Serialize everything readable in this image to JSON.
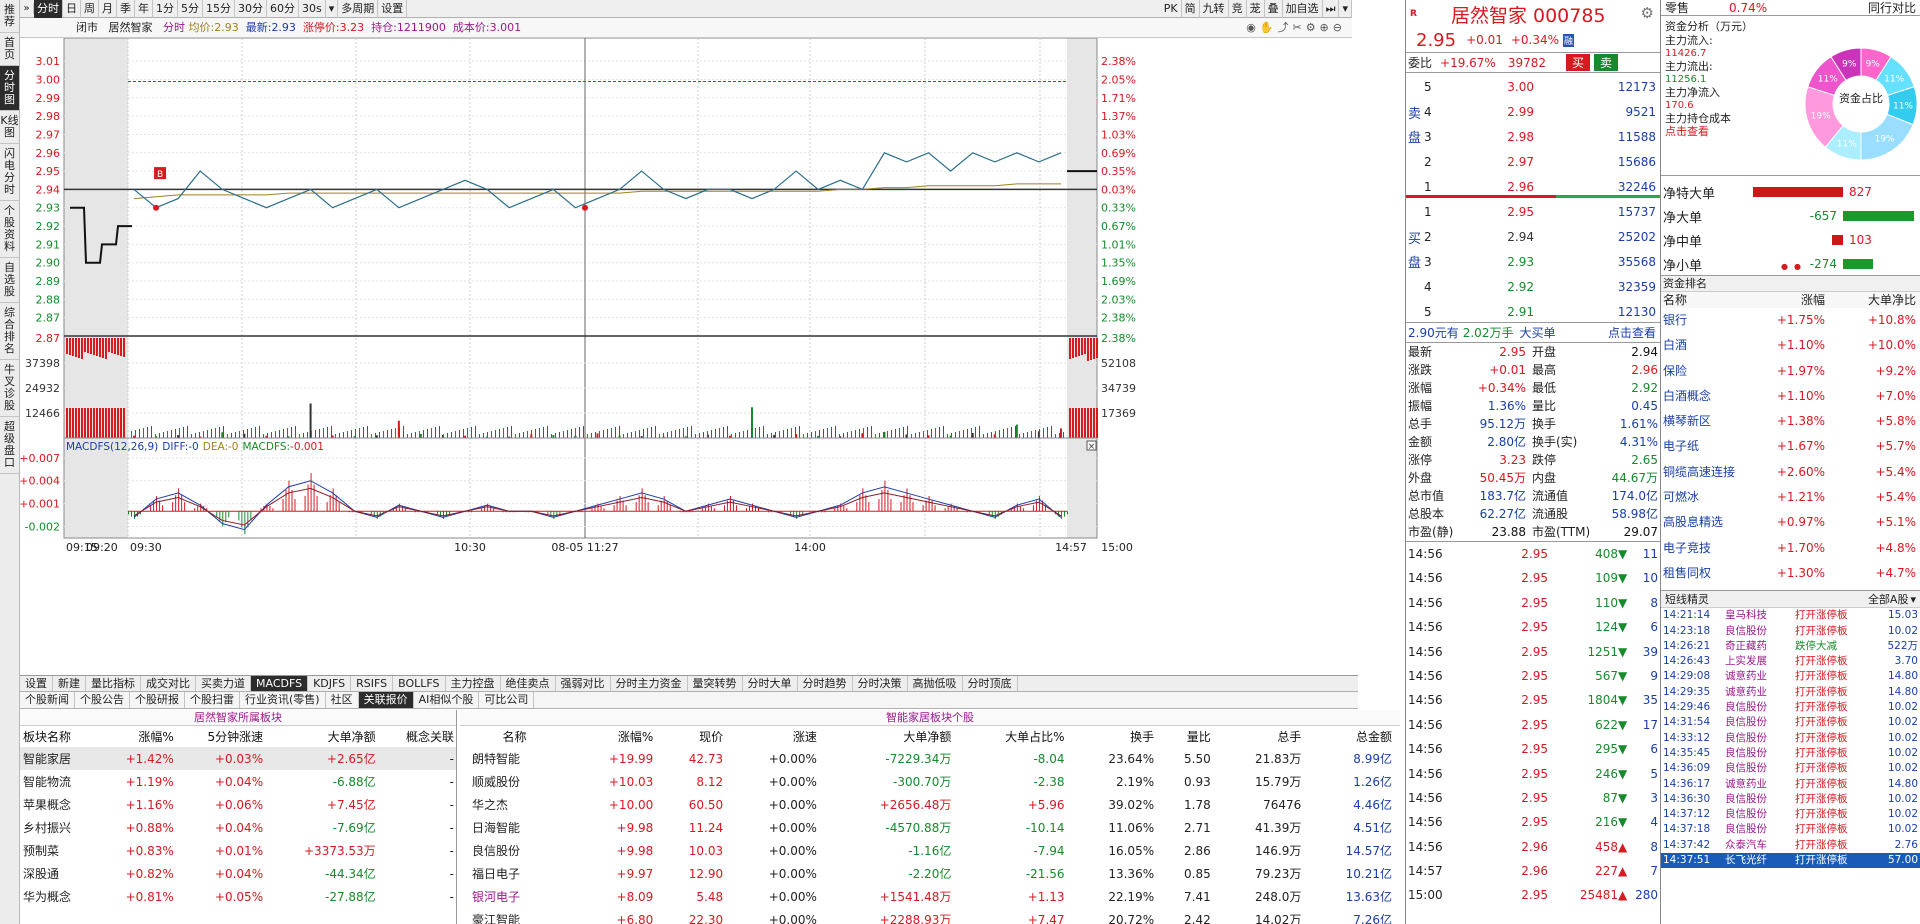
{
  "vtabs": [
    "推荐",
    "首页",
    "分时图",
    "K线图",
    "闪电分时",
    "个股资料",
    "自选股",
    "综合排名",
    "牛叉诊股",
    "超级盘口"
  ],
  "vtab_active": 2,
  "toolbar": {
    "buttons": [
      "分时",
      "日",
      "周",
      "月",
      "季",
      "年",
      "1分",
      "5分",
      "15分",
      "30分",
      "60分",
      "30s",
      "▾",
      "多周期",
      "设置"
    ],
    "active": 0,
    "right_buttons": [
      "PK",
      "简",
      "九转",
      "竞",
      "茏",
      "叠",
      "加自选",
      "⏭",
      "▾"
    ]
  },
  "info": {
    "status": "闭市",
    "name": "居然智家",
    "mode": "分时",
    "avg_label": "均价:",
    "avg": "2.93",
    "last_label": "最新:",
    "last": "2.93",
    "limit_label": "涨停价:",
    "limit": "3.23",
    "hold_label": "持仓:",
    "hold": "1211900",
    "cost_label": "成本价:",
    "cost": "3.001"
  },
  "chart_data": [
    {
      "type": "line",
      "name": "intraday-price",
      "ylim": [
        2.86,
        3.015
      ],
      "y_left_ticks": [
        "3.01",
        "3.00",
        "2.99",
        "2.98",
        "2.97",
        "2.96",
        "2.95",
        "2.94",
        "2.93",
        "2.92",
        "2.91",
        "2.90",
        "2.89",
        "2.88",
        "2.87"
      ],
      "y_right_ticks": [
        "2.38%",
        "2.05%",
        "1.71%",
        "1.37%",
        "1.03%",
        "0.69%",
        "0.35%",
        "0.03%",
        "0.33%",
        "0.67%",
        "1.01%",
        "1.35%",
        "1.69%",
        "2.03%",
        "2.38%"
      ],
      "prev_close": 2.94,
      "x_ticks": [
        "09:15",
        "09:20",
        "09:30",
        "10:30",
        "08-05 11:27",
        "14:00",
        "14:57",
        "15:00"
      ],
      "series": [
        {
          "values": [
            2.94,
            2.93,
            2.935,
            2.95,
            2.94,
            2.935,
            2.93,
            2.935,
            2.94,
            2.93,
            2.935,
            2.94,
            2.93,
            2.935,
            2.94,
            2.945,
            2.94,
            2.93,
            2.935,
            2.94,
            2.93,
            2.935,
            2.94,
            2.95,
            2.94,
            2.935,
            2.94,
            2.94,
            2.935,
            2.94,
            2.95,
            2.94,
            2.945,
            2.94,
            2.96,
            2.955,
            2.96,
            2.95,
            2.96,
            2.955,
            2.96,
            2.955,
            2.96
          ]
        },
        {
          "values": [
            2.935,
            2.936,
            2.937,
            2.937,
            2.937,
            2.937,
            2.937,
            2.938,
            2.938,
            2.938,
            2.938,
            2.938,
            2.938,
            2.938,
            2.938,
            2.938,
            2.938,
            2.938,
            2.938,
            2.938,
            2.938,
            2.938,
            2.938,
            2.939,
            2.939,
            2.939,
            2.939,
            2.939,
            2.939,
            2.939,
            2.939,
            2.939,
            2.94,
            2.94,
            2.941,
            2.941,
            2.942,
            2.942,
            2.942,
            2.942,
            2.943,
            2.943,
            2.943
          ]
        }
      ],
      "pre_auction": [
        2.93,
        2.9,
        2.91,
        2.92
      ]
    },
    {
      "type": "bar",
      "name": "volume",
      "y_left_ticks": [
        "37398",
        "24932",
        "12466"
      ],
      "y_right_ticks": [
        "52108",
        "34739",
        "17369"
      ],
      "values": [
        1200,
        900,
        1500,
        800,
        3000,
        2200,
        1100,
        900,
        18000,
        1300,
        1000,
        1400,
        9000,
        2100,
        1600,
        1200,
        800,
        700,
        1900,
        1500,
        1100,
        2400,
        1300,
        1000,
        700,
        900,
        1800,
        1200,
        16000,
        1500,
        2100,
        1100,
        900,
        2500,
        3200,
        1800,
        1400,
        1200,
        2600,
        1900,
        7000,
        3500,
        5000
      ]
    },
    {
      "type": "bar",
      "name": "MACDFS",
      "title": "MACDFS(12,26,9)",
      "diff_label": "DIFF:",
      "diff": "-0",
      "dea_label": "DEA:",
      "dea": "-0",
      "macd_label": "MACDFS:",
      "macd": "-0.001",
      "y_ticks": [
        "+0.007",
        "+0.004",
        "+0.001",
        "-0.002"
      ],
      "ylim": [
        -0.0035,
        0.0075
      ],
      "values": [
        -0.001,
        0.002,
        0.003,
        0.001,
        -0.002,
        -0.003,
        0.001,
        0.004,
        0.005,
        0.003,
        0.0,
        -0.001,
        0.001,
        0.0,
        -0.001,
        0.0,
        0.001,
        0.0,
        0.0,
        -0.001,
        0.0,
        0.001,
        0.002,
        0.003,
        0.002,
        0.0,
        0.001,
        0.002,
        0.001,
        0.0,
        -0.001,
        0.0,
        0.001,
        0.003,
        0.004,
        0.003,
        0.002,
        0.001,
        0.0,
        -0.001,
        0.001,
        0.002,
        -0.001
      ]
    }
  ],
  "tabs1": [
    "设置",
    "新建",
    "量比指标",
    "成交对比",
    "买卖力道",
    "MACDFS",
    "KDJFS",
    "RSIFS",
    "BOLLFS",
    "主力控盘",
    "绝佳卖点",
    "强弱对比",
    "分时主力资金",
    "量突转势",
    "分时大单",
    "分时趋势",
    "分时决策",
    "高抛低吸",
    "分时顶底"
  ],
  "tabs1_active": 5,
  "tabs2": [
    "个股新闻",
    "个股公告",
    "个股研报",
    "个股扫雷",
    "行业资讯(零售)",
    "社区",
    "关联报价",
    "AI相似个股",
    "可比公司"
  ],
  "tabs2_active": 6,
  "sector": {
    "title": "居然智家所属板块",
    "headers": [
      "板块名称",
      "涨幅%",
      "5分钟涨速",
      "大单净额",
      "概念关联"
    ],
    "rows": [
      [
        "智能家居",
        "+1.42%",
        "+0.03%",
        "+2.65亿",
        "-"
      ],
      [
        "智能物流",
        "+1.19%",
        "+0.04%",
        "-6.88亿",
        "-"
      ],
      [
        "苹果概念",
        "+1.16%",
        "+0.06%",
        "+7.45亿",
        "-"
      ],
      [
        "乡村振兴",
        "+0.88%",
        "+0.04%",
        "-7.69亿",
        "-"
      ],
      [
        "预制菜",
        "+0.83%",
        "+0.01%",
        "+3373.53万",
        "-"
      ],
      [
        "深股通",
        "+0.82%",
        "+0.04%",
        "-44.34亿",
        "-"
      ],
      [
        "华为概念",
        "+0.81%",
        "+0.05%",
        "-27.88亿",
        "-"
      ]
    ]
  },
  "stocks": {
    "title": "智能家居板块个股",
    "headers": [
      "名称",
      "涨幅%",
      "现价",
      "涨速",
      "大单净额",
      "大单占比%",
      "换手",
      "量比",
      "总手",
      "总金额"
    ],
    "rows": [
      [
        "朗特智能",
        "+19.99",
        "42.73",
        "+0.00%",
        "-7229.34万",
        "-8.04",
        "23.64%",
        "5.50",
        "21.83万",
        "8.99亿"
      ],
      [
        "顺威股份",
        "+10.03",
        "8.12",
        "+0.00%",
        "-300.70万",
        "-2.38",
        "2.19%",
        "0.93",
        "15.79万",
        "1.26亿"
      ],
      [
        "华之杰",
        "+10.00",
        "60.50",
        "+0.00%",
        "+2656.48万",
        "+5.96",
        "39.02%",
        "1.78",
        "76476",
        "4.46亿"
      ],
      [
        "日海智能",
        "+9.98",
        "11.24",
        "+0.00%",
        "-4570.88万",
        "-10.14",
        "11.06%",
        "2.71",
        "41.39万",
        "4.51亿"
      ],
      [
        "良信股份",
        "+9.98",
        "10.03",
        "+0.00%",
        "-1.16亿",
        "-7.94",
        "16.05%",
        "2.86",
        "146.9万",
        "14.57亿"
      ],
      [
        "福日电子",
        "+9.97",
        "12.90",
        "+0.00%",
        "-2.20亿",
        "-21.56",
        "13.36%",
        "0.85",
        "79.23万",
        "10.21亿"
      ],
      [
        "银河电子",
        "+8.09",
        "5.48",
        "+0.00%",
        "+1541.48万",
        "+1.13",
        "22.19%",
        "7.41",
        "248.0万",
        "13.63亿"
      ],
      [
        "豪江智能",
        "+6.80",
        "22.30",
        "+0.00%",
        "+2288.93万",
        "+7.47",
        "20.72%",
        "2.42",
        "14.02万",
        "7.26亿"
      ]
    ]
  },
  "quote": {
    "name": "居然智家 000785",
    "price": "2.95",
    "change": "+0.01",
    "pct": "+0.34%",
    "webi_label": "委比",
    "webi": "+19.67%",
    "webi_diff": "39782",
    "buy_btn": "买",
    "sell_btn": "卖",
    "sell": [
      [
        "5",
        "3.00",
        "12173"
      ],
      [
        "4",
        "2.99",
        "9521"
      ],
      [
        "3",
        "2.98",
        "11588"
      ],
      [
        "2",
        "2.97",
        "15686"
      ],
      [
        "1",
        "2.96",
        "32246"
      ]
    ],
    "buy": [
      [
        "1",
        "2.95",
        "15737"
      ],
      [
        "2",
        "2.94",
        "25202"
      ],
      [
        "3",
        "2.93",
        "35568"
      ],
      [
        "4",
        "2.92",
        "32359"
      ],
      [
        "5",
        "2.91",
        "12130"
      ]
    ],
    "sell_side": "卖盘",
    "buy_side": "买盘",
    "big_order": {
      "price": "2.90元有",
      "amount": "2.02万手",
      "label": "大买单",
      "link": "点击查看"
    },
    "stats": [
      [
        "最新",
        "2.95",
        "开盘",
        "2.94"
      ],
      [
        "涨跌",
        "+0.01",
        "最高",
        "2.96"
      ],
      [
        "涨幅",
        "+0.34%",
        "最低",
        "2.92"
      ],
      [
        "振幅",
        "1.36%",
        "量比",
        "0.45"
      ],
      [
        "总手",
        "95.12万",
        "换手",
        "1.61%"
      ],
      [
        "金额",
        "2.80亿",
        "换手(实)",
        "4.31%"
      ],
      [
        "涨停",
        "3.23",
        "跌停",
        "2.65"
      ],
      [
        "外盘",
        "50.45万",
        "内盘",
        "44.67万"
      ],
      [
        "总市值",
        "183.7亿",
        "流通值",
        "174.0亿"
      ],
      [
        "总股本",
        "62.27亿",
        "流通股",
        "58.98亿"
      ],
      [
        "市盈(静)",
        "23.88",
        "市盈(TTM)",
        "29.07"
      ]
    ],
    "ticks": [
      [
        "14:56",
        "2.95",
        "408",
        "down",
        "11"
      ],
      [
        "14:56",
        "2.95",
        "109",
        "down",
        "10"
      ],
      [
        "14:56",
        "2.95",
        "110",
        "down",
        "8"
      ],
      [
        "14:56",
        "2.95",
        "124",
        "down",
        "6"
      ],
      [
        "14:56",
        "2.95",
        "1251",
        "down",
        "39"
      ],
      [
        "14:56",
        "2.95",
        "567",
        "down",
        "9"
      ],
      [
        "14:56",
        "2.95",
        "1804",
        "down",
        "35"
      ],
      [
        "14:56",
        "2.95",
        "622",
        "down",
        "17"
      ],
      [
        "14:56",
        "2.95",
        "295",
        "down",
        "6"
      ],
      [
        "14:56",
        "2.95",
        "246",
        "down",
        "5"
      ],
      [
        "14:56",
        "2.95",
        "87",
        "down",
        "3"
      ],
      [
        "14:56",
        "2.95",
        "216",
        "down",
        "4"
      ],
      [
        "14:56",
        "2.96",
        "458",
        "up",
        "8"
      ],
      [
        "14:57",
        "2.96",
        "227",
        "up",
        "7"
      ],
      [
        "15:00",
        "2.95",
        "25481",
        "up",
        "280"
      ]
    ]
  },
  "fund": {
    "top_left": "零售",
    "top_pct": "0.74%",
    "top_right": "同行对比",
    "title": "资金分析（万元）",
    "inflow_label": "主力流入:",
    "inflow": "11426.7",
    "outflow_label": "主力流出:",
    "outflow": "11256.1",
    "net_label": "主力净流入",
    "net": "170.6",
    "cost_label": "主力持仓成本",
    "cost_link": "点击查看",
    "donut_label": "资金占比",
    "donut": [
      {
        "label": "9%",
        "value": 9,
        "color": "#ff66cc"
      },
      {
        "label": "11%",
        "value": 11,
        "color": "#66e0ff"
      },
      {
        "label": "11%",
        "value": 11,
        "color": "#33ccee"
      },
      {
        "label": "19%",
        "value": 19,
        "color": "#99ddff"
      },
      {
        "label": "11%",
        "value": 11,
        "color": "#aaeeff"
      },
      {
        "label": "19%",
        "value": 19,
        "color": "#ff99dd"
      },
      {
        "label": "11%",
        "value": 11,
        "color": "#ee55cc"
      },
      {
        "label": "9%",
        "value": 9,
        "color": "#cc33bb"
      }
    ],
    "net_bars": [
      {
        "label": "净特大单",
        "value": 827
      },
      {
        "label": "净大单",
        "value": -657
      },
      {
        "label": "净中单",
        "value": 103
      },
      {
        "label": "净小单",
        "value": -274
      }
    ],
    "rank_title": "资金排名",
    "rank_headers": [
      "名称",
      "涨幅",
      "大单净比"
    ],
    "rank": [
      [
        "银行",
        "+1.75%",
        "+10.8%"
      ],
      [
        "白酒",
        "+1.10%",
        "+10.0%"
      ],
      [
        "保险",
        "+1.97%",
        "+9.2%"
      ],
      [
        "白酒概念",
        "+1.10%",
        "+7.0%"
      ],
      [
        "横琴新区",
        "+1.38%",
        "+5.8%"
      ],
      [
        "电子纸",
        "+1.67%",
        "+5.7%"
      ],
      [
        "铜缆高速连接",
        "+2.60%",
        "+5.4%"
      ],
      [
        "可燃冰",
        "+1.21%",
        "+5.4%"
      ],
      [
        "高股息精选",
        "+0.97%",
        "+5.1%"
      ],
      [
        "电子竞技",
        "+1.70%",
        "+4.8%"
      ],
      [
        "租售同权",
        "+1.30%",
        "+4.7%"
      ]
    ],
    "sprite_title": "短线精灵",
    "sprite_filter": "全部A股",
    "sprite": [
      [
        "14:21:14",
        "皇马科技",
        "打开涨停板",
        "15.03"
      ],
      [
        "14:23:18",
        "良信股份",
        "打开涨停板",
        "10.02"
      ],
      [
        "14:26:21",
        "奇正藏药",
        "跌停大减",
        "522万"
      ],
      [
        "14:26:43",
        "上实发展",
        "打开涨停板",
        "3.70"
      ],
      [
        "14:29:08",
        "诚意药业",
        "打开涨停板",
        "14.80"
      ],
      [
        "14:29:35",
        "诚意药业",
        "打开涨停板",
        "14.80"
      ],
      [
        "14:29:46",
        "良信股份",
        "打开涨停板",
        "10.02"
      ],
      [
        "14:31:54",
        "良信股份",
        "打开涨停板",
        "10.02"
      ],
      [
        "14:33:12",
        "良信股份",
        "打开涨停板",
        "10.02"
      ],
      [
        "14:35:45",
        "良信股份",
        "打开涨停板",
        "10.02"
      ],
      [
        "14:36:09",
        "良信股份",
        "打开涨停板",
        "10.02"
      ],
      [
        "14:36:17",
        "诚意药业",
        "打开涨停板",
        "14.80"
      ],
      [
        "14:36:30",
        "良信股份",
        "打开涨停板",
        "10.02"
      ],
      [
        "14:37:12",
        "良信股份",
        "打开涨停板",
        "10.02"
      ],
      [
        "14:37:18",
        "良信股份",
        "打开涨停板",
        "10.02"
      ],
      [
        "14:37:42",
        "众泰汽车",
        "打开涨停板",
        "2.76"
      ],
      [
        "14:37:51",
        "长飞光纤",
        "打开涨停板",
        "57.00"
      ]
    ]
  }
}
